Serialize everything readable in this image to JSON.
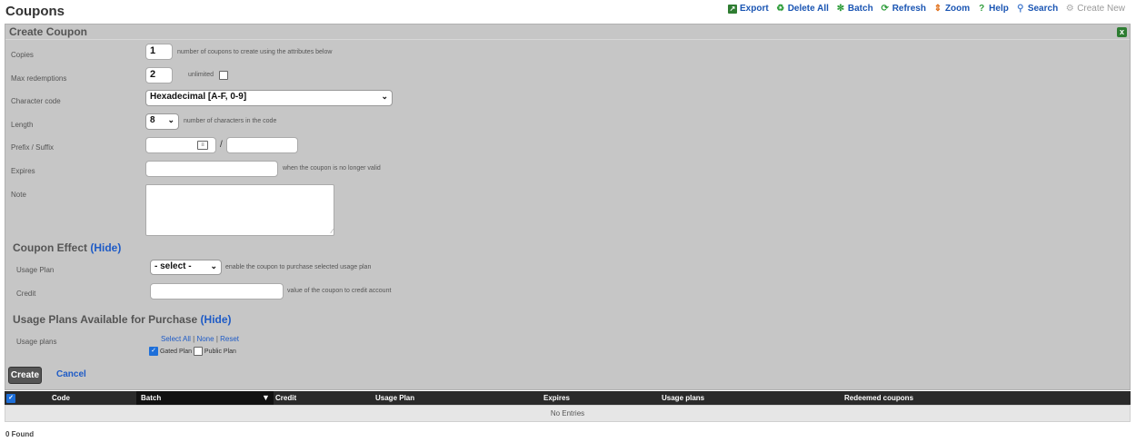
{
  "page": {
    "title": "Coupons"
  },
  "toolbar": {
    "items": [
      {
        "label": "Export",
        "icon": "export-icon"
      },
      {
        "label": "Delete All",
        "icon": "recycle-icon"
      },
      {
        "label": "Batch",
        "icon": "batch-icon"
      },
      {
        "label": "Refresh",
        "icon": "refresh-icon"
      },
      {
        "label": "Zoom",
        "icon": "zoom-icon"
      },
      {
        "label": "Help",
        "icon": "help-icon"
      },
      {
        "label": "Search",
        "icon": "search-icon"
      },
      {
        "label": "Create New",
        "icon": "create-new-icon"
      }
    ]
  },
  "form": {
    "header": "Create Coupon",
    "copies": {
      "label": "Copies",
      "value": "1",
      "hint": "number of coupons to create using the attributes below"
    },
    "max_redemptions": {
      "label": "Max redemptions",
      "value": "2",
      "unlimited_label": "unlimited"
    },
    "character_code": {
      "label": "Character code",
      "value": "Hexadecimal [A-F, 0-9]"
    },
    "length": {
      "label": "Length",
      "value": "8",
      "hint": "number of characters in the code"
    },
    "prefix_suffix": {
      "label": "Prefix / Suffix",
      "separator": "/"
    },
    "expires": {
      "label": "Expires",
      "hint": "when the coupon is no longer valid"
    },
    "note": {
      "label": "Note"
    }
  },
  "coupon_effect": {
    "title": "Coupon Effect",
    "toggle": "(Hide)",
    "usage_plan": {
      "label": "Usage Plan",
      "value": "- select -",
      "hint": "enable the coupon to purchase selected usage plan"
    },
    "credit": {
      "label": "Credit",
      "hint": "value of the coupon to credit account"
    }
  },
  "usage_plans_section": {
    "title": "Usage Plans Available for Purchase",
    "toggle": "(Hide)",
    "label": "Usage plans",
    "select_all": "Select All",
    "none": "None",
    "reset": "Reset",
    "sep": "|",
    "plans": [
      {
        "name": "Gated Plan",
        "checked": true
      },
      {
        "name": "Public Plan",
        "checked": false
      }
    ]
  },
  "actions": {
    "create": "Create",
    "cancel": "Cancel"
  },
  "grid": {
    "columns": [
      "Code",
      "Batch",
      "Credit",
      "Usage Plan",
      "Expires",
      "Usage plans",
      "Redeemed coupons"
    ],
    "empty": "No Entries",
    "found": "0 Found"
  }
}
